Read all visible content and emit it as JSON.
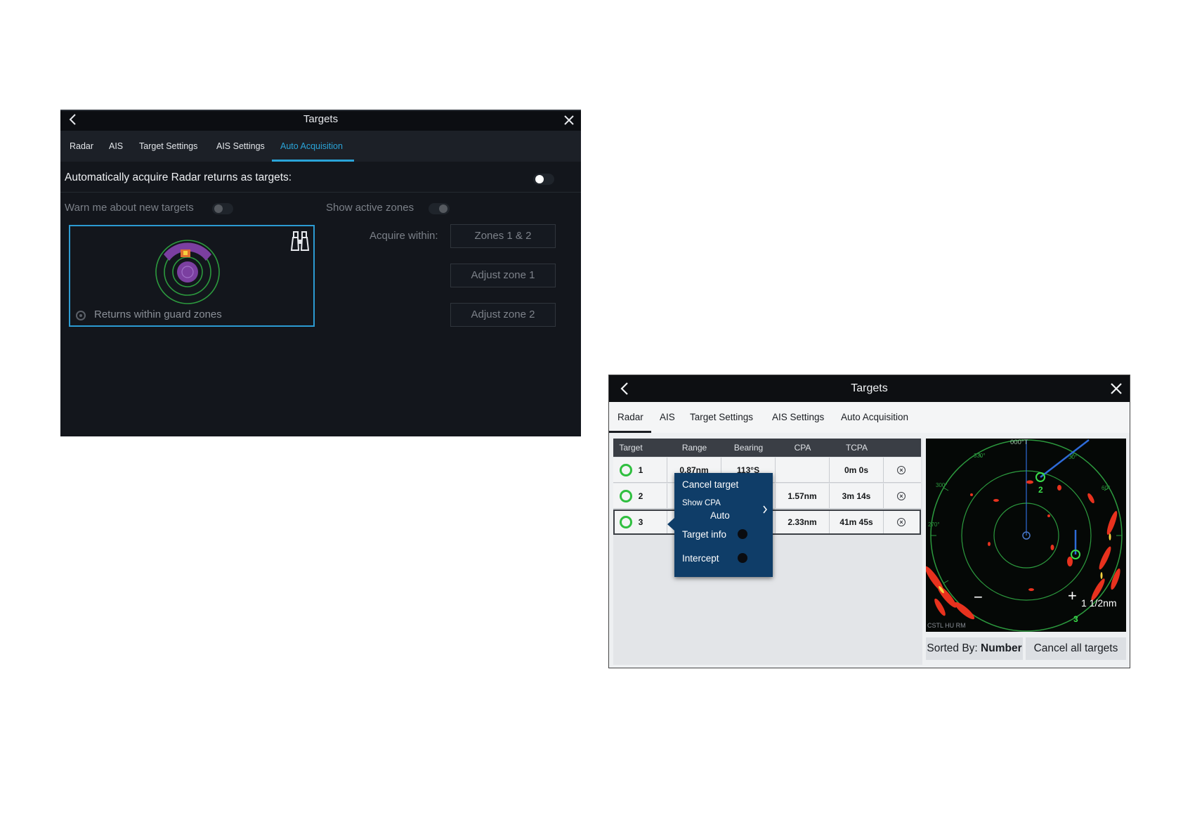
{
  "dark_panel": {
    "title": "Targets",
    "tabs": [
      {
        "label": "Radar",
        "active": false
      },
      {
        "label": "AIS",
        "active": false
      },
      {
        "label": "Target Settings",
        "active": false
      },
      {
        "label": "AIS Settings",
        "active": false
      },
      {
        "label": "Auto Acquisition",
        "active": true
      }
    ],
    "auto_acquire_label": "Automatically acquire Radar returns as targets:",
    "auto_acquire_on": false,
    "warn_label": "Warn me about new targets",
    "warn_on": false,
    "show_zones_label": "Show active zones",
    "show_zones_on": false,
    "guard_option_label": "Returns within guard zones",
    "acquire_within_label": "Acquire within:",
    "acquire_within_value": "Zones 1 & 2",
    "adjust_zone1_label": "Adjust zone 1",
    "adjust_zone2_label": "Adjust zone 2",
    "accent_color": "#2aa4d8",
    "icons": [
      "chevron-left-icon",
      "close-icon",
      "binoculars-icon",
      "radio-button-icon",
      "toggle-switch-icon"
    ]
  },
  "light_panel": {
    "title": "Targets",
    "tabs": [
      {
        "label": "Radar",
        "active": true
      },
      {
        "label": "AIS",
        "active": false
      },
      {
        "label": "Target Settings",
        "active": false
      },
      {
        "label": "AIS Settings",
        "active": false
      },
      {
        "label": "Auto Acquisition",
        "active": false
      }
    ],
    "table": {
      "headers": [
        "Target",
        "Range",
        "Bearing",
        "CPA",
        "TCPA"
      ],
      "rows": [
        {
          "target": "1",
          "range": "0.87nm",
          "bearing": "113°S",
          "cpa": "",
          "tcpa": "0m 0s"
        },
        {
          "target": "2",
          "range": "",
          "bearing": "",
          "cpa": "1.57nm",
          "tcpa": "3m 14s"
        },
        {
          "target": "3",
          "range": "",
          "bearing": "",
          "cpa": "2.33nm",
          "tcpa": "41m 45s"
        }
      ]
    },
    "context_menu": {
      "cancel_target": "Cancel target",
      "show_cpa": "Show CPA",
      "show_cpa_value": "Auto",
      "target_info": "Target info",
      "intercept": "Intercept"
    },
    "radar": {
      "heading_label": "000°T",
      "range_label": "1 1/2nm",
      "mode_label": "CSTL HU RM",
      "bearing_labels": [
        "330°",
        "30°",
        "300°",
        "60°",
        "270°"
      ],
      "target_labels": [
        "2",
        "3"
      ],
      "zoom_out": "−",
      "zoom_in": "+"
    },
    "sorted_by_label": "Sorted By:",
    "sorted_by_value": "Number",
    "cancel_all_label": "Cancel all targets",
    "target_ring_color": "#2fbf3f",
    "menu_color": "#0f3d68"
  }
}
